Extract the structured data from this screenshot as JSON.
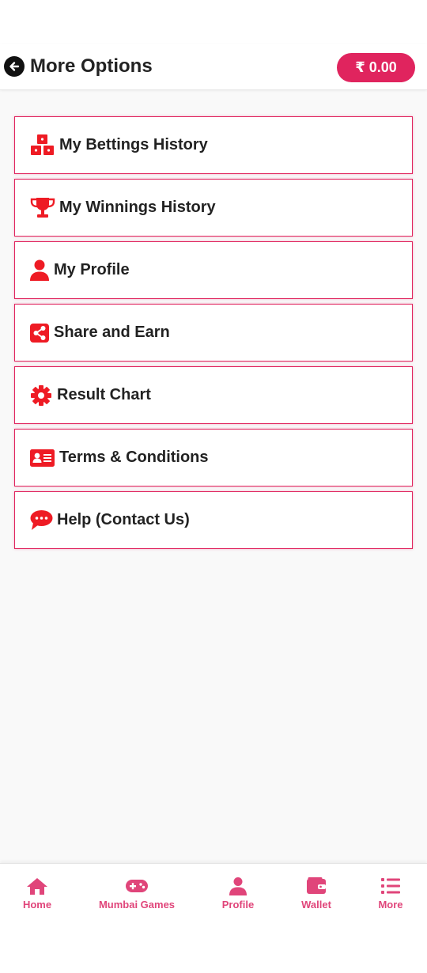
{
  "header": {
    "title": "More Options",
    "back_icon": "arrow-left-circle-icon",
    "wallet_balance": "₹ 0.00"
  },
  "menu": {
    "items": [
      {
        "label": "My Bettings History",
        "icon": "cubes-icon"
      },
      {
        "label": "My Winnings History",
        "icon": "trophy-icon"
      },
      {
        "label": "My Profile",
        "icon": "user-icon"
      },
      {
        "label": "Share and Earn",
        "icon": "share-icon"
      },
      {
        "label": "Result Chart",
        "icon": "gear-icon"
      },
      {
        "label": "Terms & Conditions",
        "icon": "id-card-icon"
      },
      {
        "label": "Help (Contact Us)",
        "icon": "chat-icon"
      }
    ]
  },
  "bottom_nav": {
    "items": [
      {
        "label": "Home",
        "icon": "home-icon"
      },
      {
        "label": "Mumbai Games",
        "icon": "gamepad-icon"
      },
      {
        "label": "Profile",
        "icon": "user-icon"
      },
      {
        "label": "Wallet",
        "icon": "wallet-icon"
      },
      {
        "label": "More",
        "icon": "list-icon"
      }
    ]
  },
  "colors": {
    "accent": "#e0245e",
    "icon_red": "#ee1b24",
    "nav_pink": "#e0457a"
  }
}
